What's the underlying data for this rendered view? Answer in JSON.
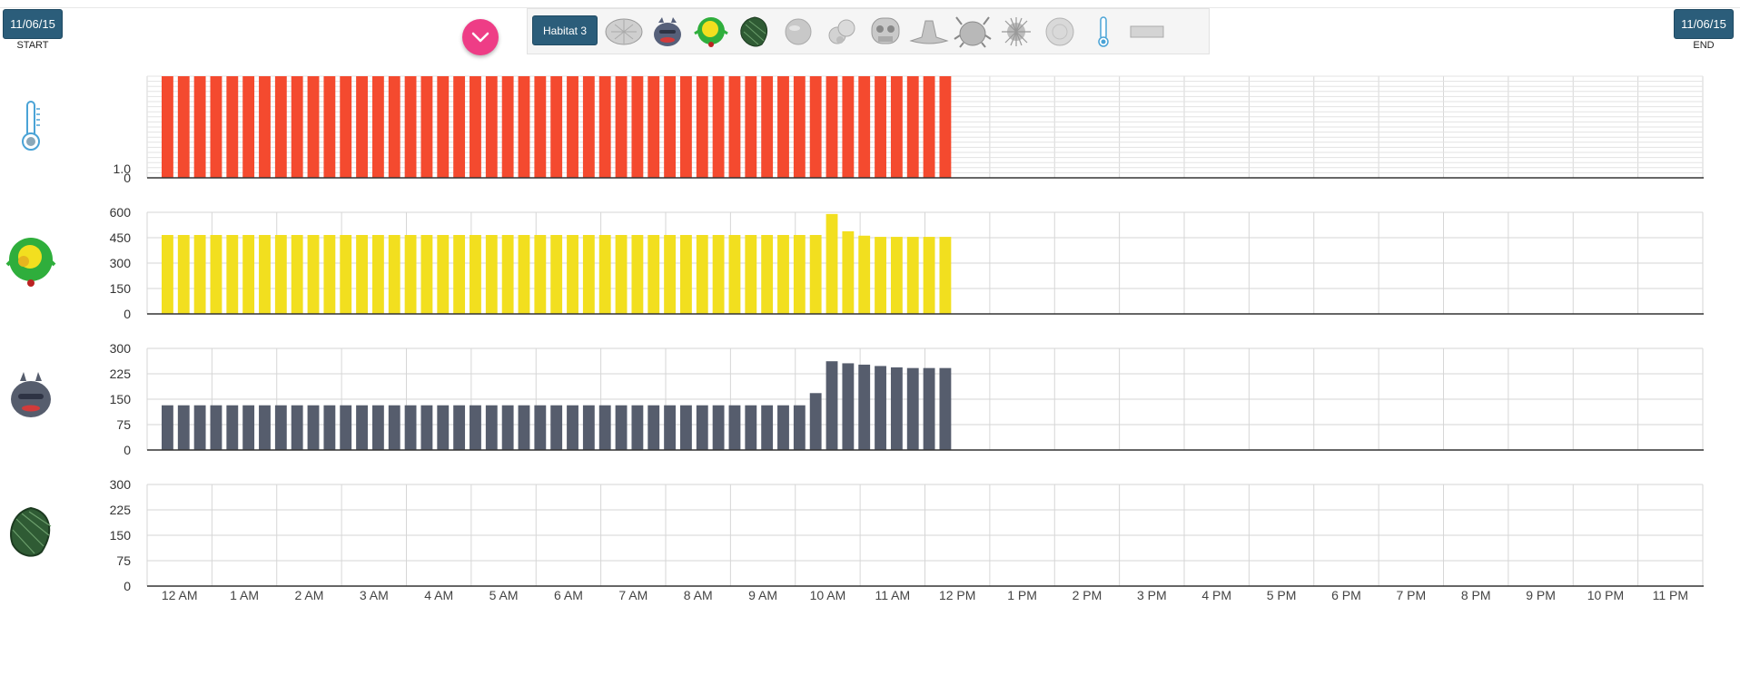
{
  "header": {
    "start_date": "11/06/15",
    "start_caption": "START",
    "end_date": "11/06/15",
    "end_caption": "END",
    "habitat_label": "Habitat 3"
  },
  "toolbar_icons": [
    "sand-dollar-icon",
    "dark-fish-icon",
    "green-yellow-fish-icon",
    "green-leafy-fish-icon",
    "round-stone-icon",
    "pebble-cluster-icon",
    "robot-icon",
    "hat-icon",
    "beetle-icon",
    "sea-urchin-icon",
    "coral-disc-icon",
    "thermometer-icon",
    "bar-icon"
  ],
  "colors": {
    "accent_button": "#2b5d7a",
    "fab": "#ee3d86",
    "temperature": "#f44a2f",
    "green_fish": "#f2df1f",
    "dark_fish": "#565d6d",
    "leafy_fish": "#3a5f3a"
  },
  "x_axis": {
    "hour_labels": [
      "12 AM",
      "1 AM",
      "2 AM",
      "3 AM",
      "4 AM",
      "5 AM",
      "6 AM",
      "7 AM",
      "8 AM",
      "9 AM",
      "10 AM",
      "11 AM",
      "12 PM",
      "1 PM",
      "2 PM",
      "3 PM",
      "4 PM",
      "5 PM",
      "6 PM",
      "7 PM",
      "8 PM",
      "9 PM",
      "10 PM",
      "11 PM"
    ]
  },
  "chart_data": [
    {
      "type": "bar",
      "row": "temperature",
      "icon": "thermometer-icon",
      "color": "#f44a2f",
      "y_ticks": [
        "1.0",
        "0"
      ],
      "ylim": [
        0,
        1
      ],
      "grid": "dense",
      "values": [
        1,
        1,
        1,
        1,
        1,
        1,
        1,
        1,
        1,
        1,
        1,
        1,
        1,
        1,
        1,
        1,
        1,
        1,
        1,
        1,
        1,
        1,
        1,
        1,
        1,
        1,
        1,
        1,
        1,
        1,
        1,
        1,
        1,
        1,
        1,
        1,
        1,
        1,
        1,
        1,
        1,
        1,
        1,
        1,
        1,
        1,
        1,
        1,
        1
      ]
    },
    {
      "type": "bar",
      "row": "green-yellow-fish",
      "icon": "green-yellow-fish-icon",
      "color": "#f2df1f",
      "y_ticks": [
        "600",
        "450",
        "300",
        "150",
        "0"
      ],
      "ylim": [
        0,
        600
      ],
      "values": [
        466,
        466,
        466,
        466,
        466,
        466,
        466,
        466,
        466,
        466,
        466,
        466,
        466,
        466,
        466,
        466,
        466,
        466,
        466,
        466,
        466,
        466,
        466,
        466,
        466,
        466,
        466,
        466,
        466,
        466,
        466,
        466,
        466,
        466,
        466,
        466,
        466,
        466,
        466,
        466,
        466,
        590,
        488,
        462,
        455,
        455,
        455,
        455,
        455
      ]
    },
    {
      "type": "bar",
      "row": "dark-fish",
      "icon": "dark-fish-icon",
      "color": "#565d6d",
      "y_ticks": [
        "300",
        "225",
        "150",
        "75",
        "0"
      ],
      "ylim": [
        0,
        300
      ],
      "values": [
        132,
        132,
        132,
        132,
        132,
        132,
        132,
        132,
        132,
        132,
        132,
        132,
        132,
        132,
        132,
        132,
        132,
        132,
        132,
        132,
        132,
        132,
        132,
        132,
        132,
        132,
        132,
        132,
        132,
        132,
        132,
        132,
        132,
        132,
        132,
        132,
        132,
        132,
        132,
        132,
        168,
        262,
        256,
        252,
        248,
        244,
        242,
        242,
        242
      ]
    },
    {
      "type": "bar",
      "row": "leafy-fish",
      "icon": "green-leafy-fish-icon",
      "color": "#3a5f3a",
      "y_ticks": [
        "300",
        "225",
        "150",
        "75",
        "0"
      ],
      "ylim": [
        0,
        300
      ],
      "values": []
    }
  ]
}
